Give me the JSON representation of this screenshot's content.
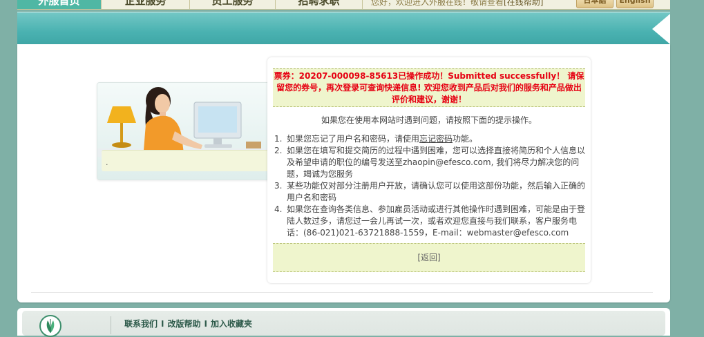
{
  "nav": {
    "tabs": [
      {
        "label": "外服首页"
      },
      {
        "label": "企业服务"
      },
      {
        "label": "员工服务"
      },
      {
        "label": "招聘求职"
      }
    ],
    "welcome_text": "您好，欢迎进入外服在线！敬请查看",
    "help_link": "[在线帮助]",
    "lang_jp": "日本語",
    "lang_en": "English"
  },
  "message": {
    "success_text": "票券：20207-000098-85613已操作成功！Submitted successfully！ 请保留您的券号，再次登录可查询快递信息! 欢迎您收到产品后对我们的服务和产品做出评价和建议，谢谢！",
    "intro": "如果您在使用本网站时遇到问题，请按照下面的提示操作。",
    "items": [
      {
        "num": "1.",
        "before": "如果您忘记了用户名和密码，请使用",
        "link": "忘记密码",
        "after": "功能。"
      },
      {
        "num": "2.",
        "text": "如果您在填写和提交简历的过程中遇到困难，您可以选择直接将简历和个人信息以及希望申请的职位的编号发送至zhaopin@efesco.com, 我们将尽力解决您的问题，竭诚为您服务"
      },
      {
        "num": "3.",
        "text": "某些功能仅对部分注册用户开放，请确认您可以使用这部份功能，然后输入正确的用户名和密码"
      },
      {
        "num": "4.",
        "text": "如果您在查询各类信息、参加雇员活动或进行其他操作时遇到困难，可能是由于登陆人数过多，请您过一会儿再试一次，或者欢迎您直接与我们联系，客户服务电话：(86-021)021-63721888-1559，E-mail：webmaster@efesco.com"
      }
    ],
    "back_link": "[返回]"
  },
  "photo": {
    "caption": "."
  },
  "footer": {
    "links": [
      "联系我们",
      "改版帮助",
      "加入收藏夹"
    ],
    "separator": "I"
  },
  "colors": {
    "teal": "#4ab2b1",
    "success_red": "#e60012",
    "highlight_bg": "#eff5cd",
    "page_bg": "#7fb0a6"
  }
}
